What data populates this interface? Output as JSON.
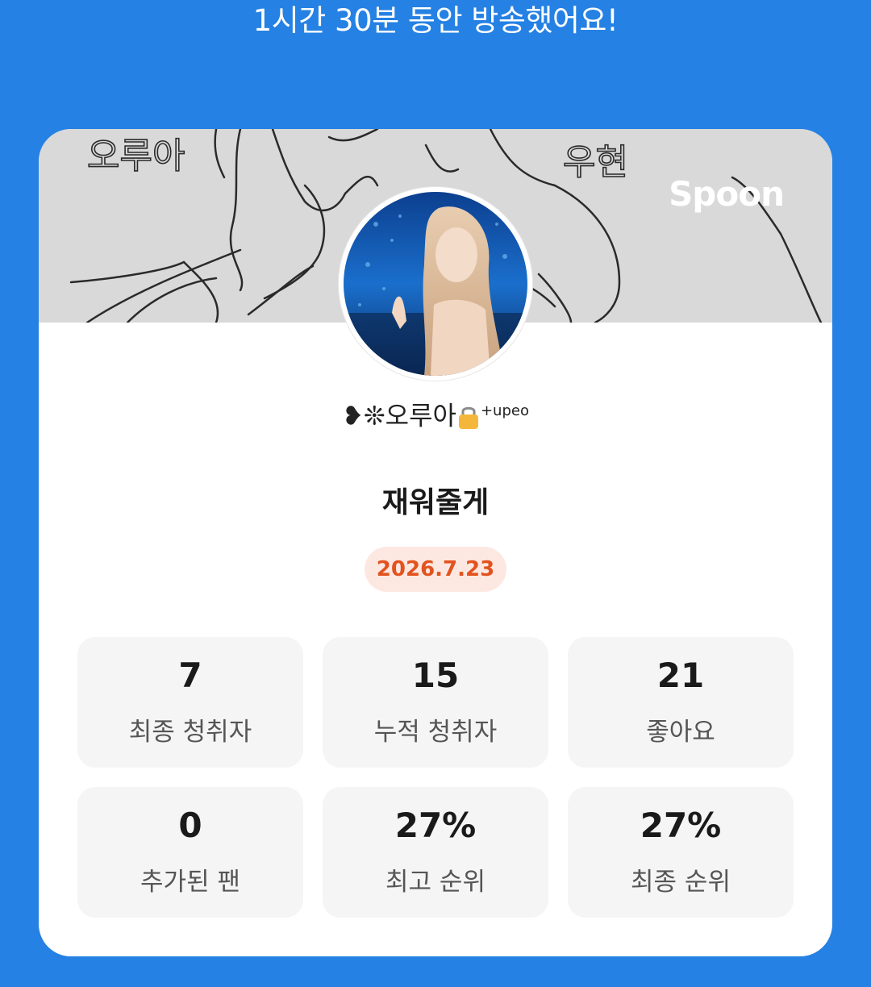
{
  "headline": "1시간 30분 동안 방송했어요!",
  "banner": {
    "brand": "Spoon",
    "drawing_text_left": "오루아",
    "drawing_text_right": "우현"
  },
  "profile": {
    "nickname_prefix": "❥❊",
    "nickname_main": "오루아",
    "nickname_suffix": "+up",
    "nickname_tail": "eo"
  },
  "broadcast": {
    "title": "재워줄게",
    "date": "2026.7.23"
  },
  "stats": [
    {
      "value": "7",
      "label": "최종 청취자"
    },
    {
      "value": "15",
      "label": "누적 청취자"
    },
    {
      "value": "21",
      "label": "좋아요"
    },
    {
      "value": "0",
      "label": "추가된 팬"
    },
    {
      "value": "27%",
      "label": "최고 순위"
    },
    {
      "value": "27%",
      "label": "최종 순위"
    }
  ],
  "colors": {
    "background": "#2581e3",
    "card": "#ffffff",
    "date_text": "#e2531f",
    "date_bg": "#fde8e1",
    "stat_bg": "#f5f5f5"
  },
  "icons": [
    "lock-icon",
    "avatar-image",
    "banner-drawing"
  ]
}
